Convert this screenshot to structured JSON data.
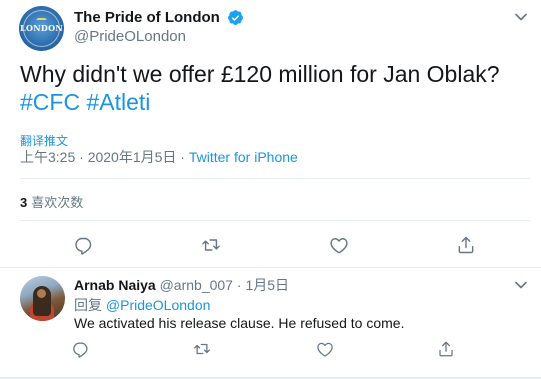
{
  "tweet": {
    "display_name": "The Pride of London",
    "handle": "@PrideOLondon",
    "avatar_text": "LONDON",
    "text_line1": "Why didn't we offer £120 million for Jan Oblak?",
    "hashtags": [
      "#CFC",
      "#Atleti"
    ],
    "translate_label": "翻译推文",
    "timestamp": "上午3:25 · 2020年1月5日 · ",
    "source": "Twitter for iPhone",
    "likes_count": "3",
    "likes_label": "喜欢次数",
    "more_icon": "chevron-down-icon"
  },
  "actions": {
    "reply_icon": "reply-icon",
    "retweet_icon": "retweet-icon",
    "like_icon": "heart-icon",
    "share_icon": "share-icon"
  },
  "reply": {
    "display_name": "Arnab Naiya",
    "handle": "@arnb_007",
    "separator": "·",
    "date": "1月5日",
    "reply_prefix": "回复",
    "reply_to": "@PrideOLondon",
    "text": "We activated his release clause. He refused to come."
  },
  "colors": {
    "accent": "#1b95e0",
    "muted": "#657786",
    "text": "#14171a",
    "divider": "#e6ecf0",
    "verified": "#1da1f2"
  }
}
